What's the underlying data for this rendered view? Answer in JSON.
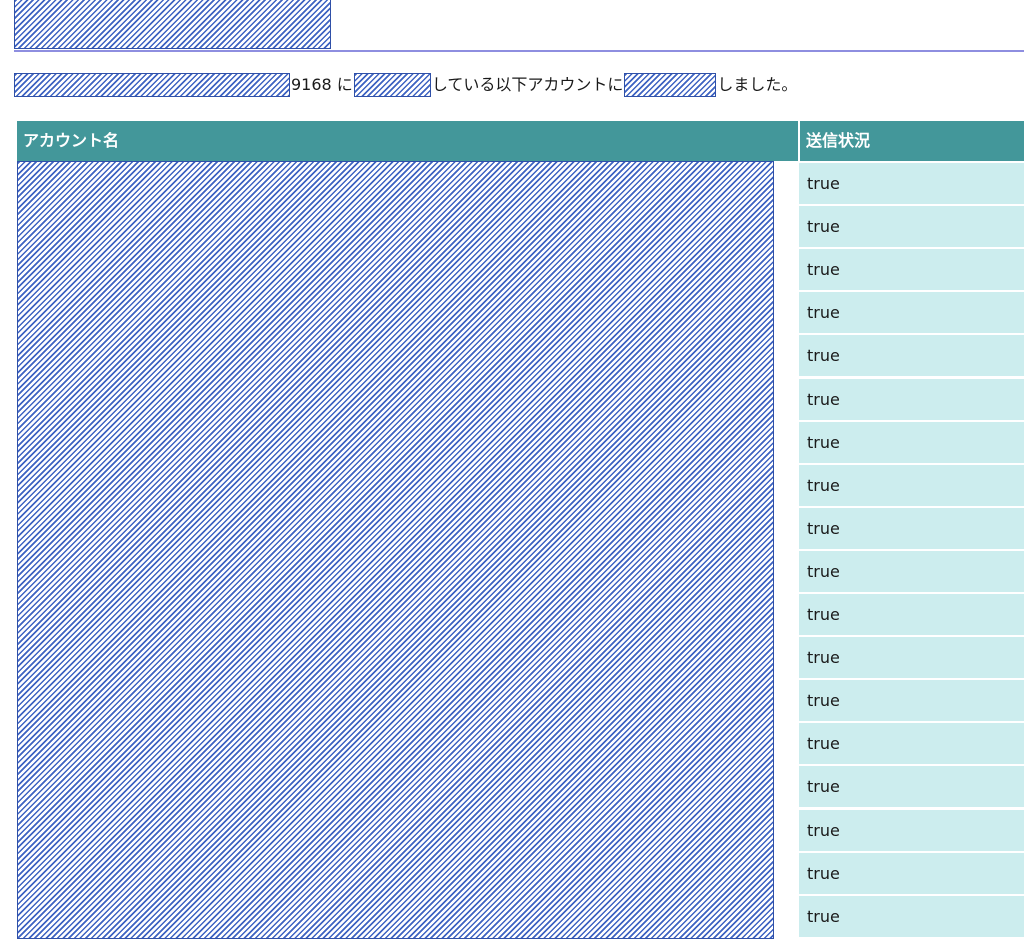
{
  "message": {
    "part1": "9168 に",
    "part2": "している以下アカウントに",
    "part3": "しました。"
  },
  "table": {
    "headers": {
      "account_name": "アカウント名",
      "send_status": "送信状況"
    },
    "rows": [
      {
        "status": "true"
      },
      {
        "status": "true"
      },
      {
        "status": "true"
      },
      {
        "status": "true"
      },
      {
        "status": "true"
      },
      {
        "status": "true"
      },
      {
        "status": "true"
      },
      {
        "status": "true"
      },
      {
        "status": "true"
      },
      {
        "status": "true"
      },
      {
        "status": "true"
      },
      {
        "status": "true"
      },
      {
        "status": "true"
      },
      {
        "status": "true"
      },
      {
        "status": "true"
      },
      {
        "status": "true"
      },
      {
        "status": "true"
      },
      {
        "status": "true"
      }
    ]
  },
  "colors": {
    "header_bg": "#43979a",
    "cell_bg": "#ccedee",
    "rule": "#8e8ee0",
    "redaction": "#3e63c2"
  }
}
